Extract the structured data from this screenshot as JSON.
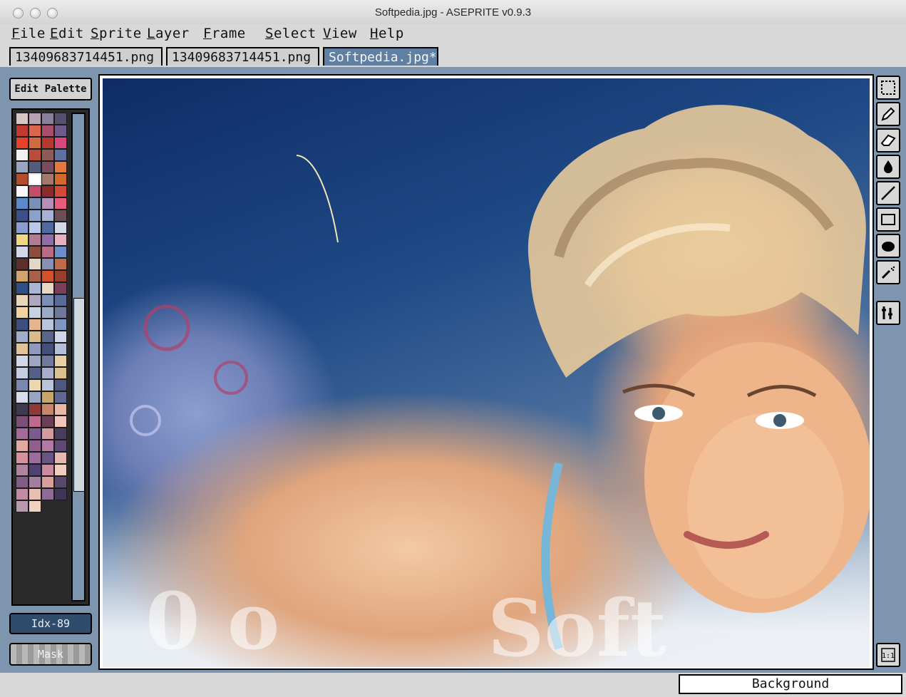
{
  "window": {
    "title": "Softpedia.jpg - ASEPRITE v0.9.3"
  },
  "menu": [
    {
      "first": "F",
      "rest": "ile"
    },
    {
      "first": "E",
      "rest": "dit"
    },
    {
      "first": "S",
      "rest": "prite"
    },
    {
      "first": "L",
      "rest": "ayer"
    },
    {
      "first": "F",
      "rest": "rame"
    },
    {
      "first": "S",
      "rest": "elect"
    },
    {
      "first": "V",
      "rest": "iew"
    },
    {
      "first": "H",
      "rest": "elp"
    }
  ],
  "tabs": [
    {
      "label": "13409683714451.png",
      "active": false
    },
    {
      "label": "13409683714451.png",
      "active": false
    },
    {
      "label": "Softpedia.jpg*",
      "active": true
    }
  ],
  "palette": {
    "edit_button": "Edit Palette",
    "index_label": "Idx-89",
    "mask_button": "Mask",
    "colors": [
      "#d8c7c3",
      "#b6a2b0",
      "#8a7f9a",
      "#54506f",
      "#c23a2f",
      "#d9664d",
      "#a84d6b",
      "#6e5a8c",
      "#e8412b",
      "#d06a3f",
      "#b6392f",
      "#d44a7f",
      "#f1f1f1",
      "#b94c3a",
      "#8e5b56",
      "#5e71a2",
      "#9aa5c1",
      "#545b7d",
      "#7b4c5f",
      "#e5773f",
      "#b34d29",
      "#ffffff",
      "#a4786c",
      "#d36a2a",
      "#f6f6f6",
      "#c44d6c",
      "#8d2b2b",
      "#d14a3a",
      "#5a8acb",
      "#7c8fb6",
      "#b58fb5",
      "#e85c7b",
      "#3c4f8a",
      "#8aa1cd",
      "#a7b2d6",
      "#6b4f55",
      "#8b9dd0",
      "#b8c8e6",
      "#4e6aa0",
      "#d4d9ea",
      "#f1d782",
      "#b37a93",
      "#8f6ea8",
      "#e6b0c0",
      "#d4d7e9",
      "#8b4e3f",
      "#b86c87",
      "#6c8ec9",
      "#5d2e2a",
      "#e3d7c8",
      "#8b8fb6",
      "#c06a4c",
      "#d2a26f",
      "#a8604a",
      "#d3522d",
      "#9b3d2c",
      "#2e4f8a",
      "#a7b6d6",
      "#e8d8c3",
      "#7b3f5a",
      "#e9d6b8",
      "#b0a7bf",
      "#7c8fb8",
      "#5a6b9a",
      "#f1d2a5",
      "#c8d1e3",
      "#9aa9c7",
      "#6d789b",
      "#3f4f7d",
      "#e4b58f",
      "#b9c5dd",
      "#7f96c0",
      "#a1aecb",
      "#d9ba8a",
      "#59658d",
      "#cfd6e7",
      "#e1c39a",
      "#8e99bd",
      "#44507a",
      "#b4bfd8",
      "#d3d8e6",
      "#9ca5c2",
      "#6f7aa0",
      "#e7d0a6",
      "#c4cde2",
      "#565f87",
      "#a6aecb",
      "#dcc08e",
      "#7a88b2",
      "#edd7ae",
      "#bac4db",
      "#4e5781",
      "#d6dcea",
      "#9aa3c0",
      "#c9a56e",
      "#5f6890",
      "#3e3a52",
      "#8e3a36",
      "#c9856a",
      "#e9b9a6",
      "#7b4f77",
      "#bd6a8c",
      "#6c3f57",
      "#f0c6b8",
      "#a56a9a",
      "#7a5a8f",
      "#d49a9e",
      "#4a3e5e",
      "#e2a8a2",
      "#8f5f8f",
      "#b27aa6",
      "#5c4a72",
      "#d7909e",
      "#9a6d9c",
      "#6a5485",
      "#e6b7ae",
      "#b1849e",
      "#4f4270",
      "#ca8a9f",
      "#f2cdbf",
      "#7f5d86",
      "#a57da0",
      "#d89e9a",
      "#5a476e",
      "#c28aa3",
      "#e8c0b2",
      "#8d6c94",
      "#3f3657",
      "#b79aae",
      "#efd2c0"
    ]
  },
  "canvas": {
    "image_alt": "Softpedia photo"
  },
  "tools": [
    "marquee-tool-icon",
    "pencil-tool-icon",
    "eraser-tool-icon",
    "bucket-fill-icon",
    "line-tool-icon",
    "rectangle-tool-icon",
    "ellipse-tool-icon",
    "spray-tool-icon",
    "configure-tool-icon",
    "zoom-1-1-icon"
  ],
  "status": {
    "layer_name": "Background"
  }
}
